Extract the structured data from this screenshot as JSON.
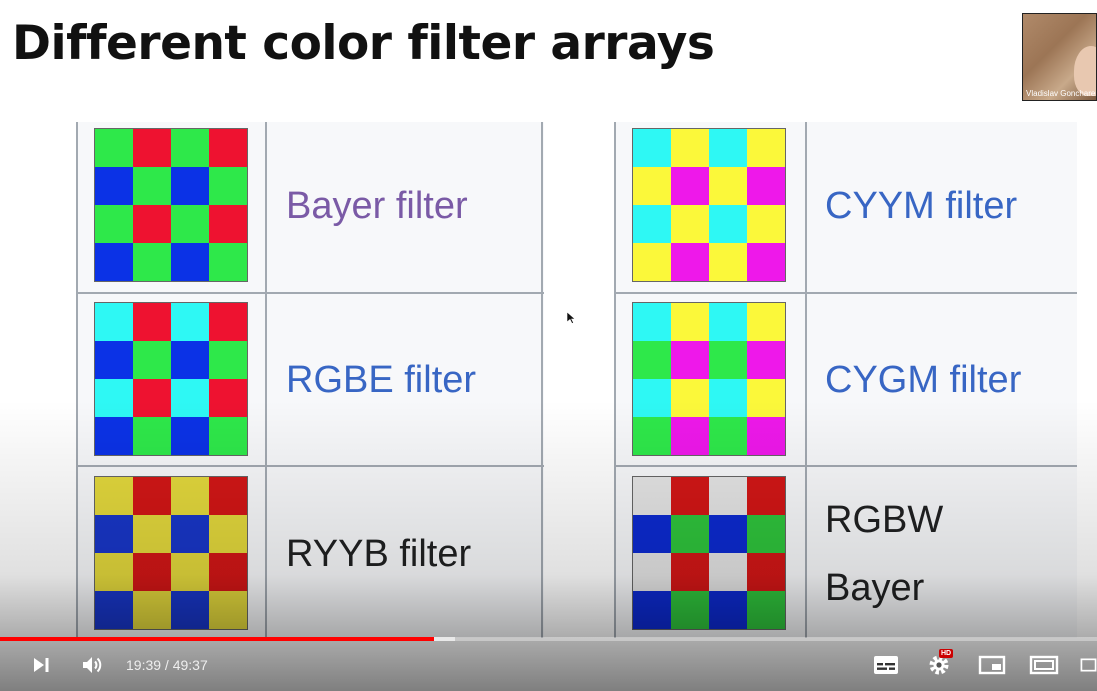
{
  "slide": {
    "title": "Different color filter arrays",
    "webcam_name": "Vladislav Goncharenko"
  },
  "colors": {
    "G": "#2ee84a",
    "R": "#ee1230",
    "B": "#0b32e6",
    "C": "#2ef8f4",
    "Y": "#fbf83a",
    "M": "#ee18ea",
    "y": "#e3d83c",
    "r": "#d21616",
    "b": "#1836c8",
    "W": "#e4e4e4",
    "g": "#2fc43c",
    "k": "#0c2ad0"
  },
  "filters": [
    {
      "id": "bayer",
      "name": "Bayer filter",
      "color": "#7a5aa6",
      "pattern": [
        "GRGR",
        "BGBG",
        "GRGR",
        "BGBG"
      ]
    },
    {
      "id": "rgbe",
      "name": "RGBE filter",
      "color": "#3866c4",
      "pattern": [
        "CRCR",
        "BGBG",
        "CRCR",
        "BGBG"
      ]
    },
    {
      "id": "ryyb",
      "name": "RYYB filter",
      "color": "#202122",
      "pattern": [
        "yryr",
        "byby",
        "yryr",
        "byby"
      ]
    },
    {
      "id": "cyym",
      "name": "CYYM filter",
      "color": "#3866c4",
      "pattern": [
        "CYCY",
        "YMYM",
        "CYCY",
        "YMYM"
      ]
    },
    {
      "id": "cygm",
      "name": "CYGM filter",
      "color": "#3866c4",
      "pattern": [
        "CYCY",
        "GMGM",
        "CYCY",
        "GMGM"
      ]
    },
    {
      "id": "rgbw",
      "name_line1": "RGBW",
      "name_line2": "Bayer",
      "color": "#202122",
      "pattern": [
        "WrWr",
        "kgkg",
        "WrWr",
        "kgkg"
      ]
    }
  ],
  "player": {
    "time": "19:39 / 49:37",
    "progress": 0.3958,
    "buffered": 0.415,
    "hd_badge": "HD",
    "icons": [
      "next-icon",
      "volume-icon",
      "subtitles-icon",
      "settings-icon",
      "miniplayer-icon",
      "theater-mode-icon",
      "fullscreen-icon"
    ]
  }
}
